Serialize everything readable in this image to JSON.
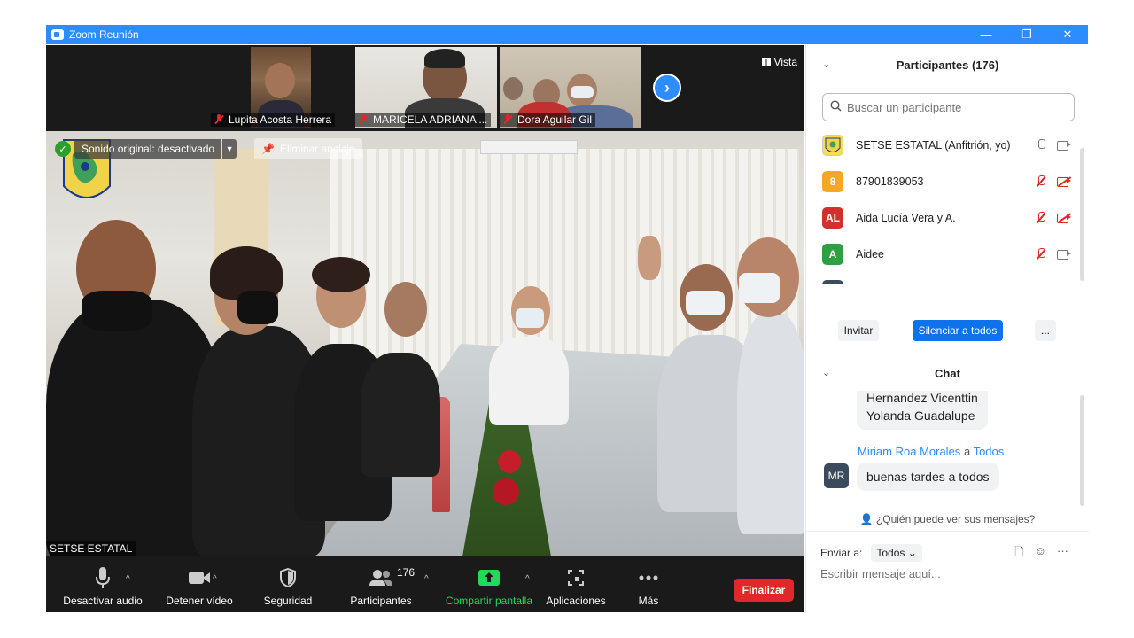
{
  "window": {
    "title": "Zoom Reunión",
    "minimize": "—",
    "restore": "❐",
    "close": "✕"
  },
  "video": {
    "thumbnails": [
      {
        "name": "Lupita Acosta Herrera"
      },
      {
        "name": "MARICELA ADRIANA ..."
      },
      {
        "name": "Dora Aguilar Gil"
      }
    ],
    "next_arrow": "›",
    "view_label": "Vista",
    "sound_original": "Sonido original: desactivado",
    "unpin_label": "Eliminar anclaje",
    "speaker_name": "SETSE ESTATAL"
  },
  "toolbar": {
    "mute_label": "Desactivar audio",
    "video_label": "Detener vídeo",
    "security_label": "Seguridad",
    "participants_label": "Participantes",
    "participants_count": "176",
    "share_label": "Compartir pantalla",
    "apps_label": "Aplicaciones",
    "more_label": "Más",
    "end_label": "Finalizar"
  },
  "participants": {
    "header": "Participantes (176)",
    "search_placeholder": "Buscar un participante",
    "list": [
      {
        "initials": "",
        "name": "SETSE ESTATAL (Anfitrión, yo)",
        "color": "#f4e04d",
        "mic": "on",
        "cam": "on"
      },
      {
        "initials": "8",
        "name": "87901839053",
        "color": "#f5a623",
        "mic": "off",
        "cam": "off"
      },
      {
        "initials": "AL",
        "name": "Aida Lucía Vera y A.",
        "color": "#d0312d",
        "mic": "off",
        "cam": "off"
      },
      {
        "initials": "A",
        "name": "Aidee",
        "color": "#2ea043",
        "mic": "off",
        "cam": "on"
      }
    ],
    "invite_label": "Invitar",
    "mute_all_label": "Silenciar a todos",
    "more_label": "..."
  },
  "chat": {
    "header": "Chat",
    "messages": [
      {
        "sender": "",
        "to": "",
        "lines": [
          "Hernandez Vicenttin",
          "Yolanda Guadalupe"
        ]
      },
      {
        "sender": "Miriam Roa Morales",
        "to_word": "a",
        "to": "Todos",
        "avatar": "MR",
        "text": "buenas tardes a todos"
      }
    ],
    "who_can_see": "¿Quién puede ver sus mensajes?",
    "send_to_label": "Enviar a:",
    "send_to_value": "Todos",
    "input_placeholder": "Escribir mensaje aquí..."
  }
}
